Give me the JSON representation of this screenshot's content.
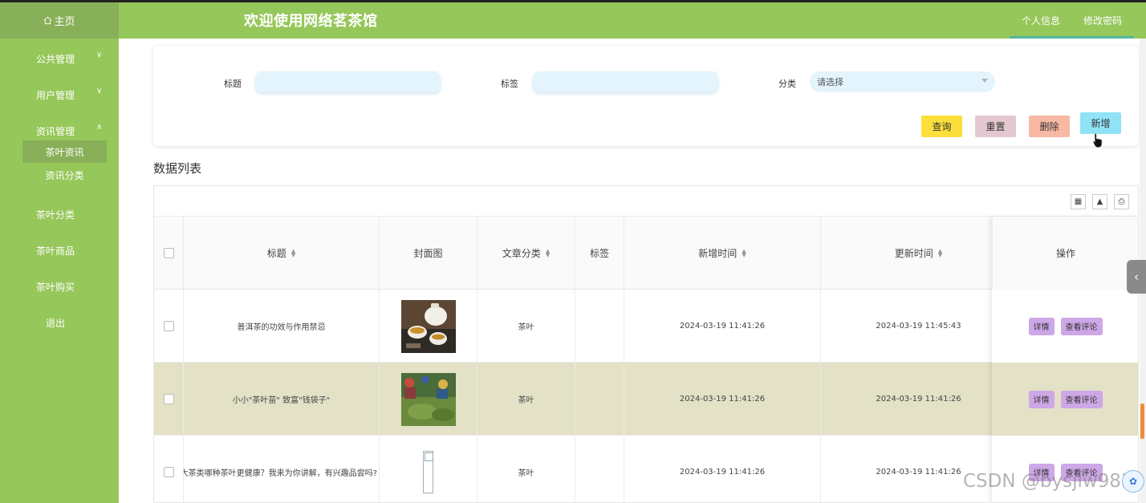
{
  "header": {
    "home_icon": "home-icon",
    "home_label": "主页",
    "title": "欢迎使用网络茗茶馆",
    "profile_link": "个人信息",
    "password_link": "修改密码"
  },
  "sidebar": {
    "items": [
      {
        "label": "公共管理",
        "expanded": false
      },
      {
        "label": "用户管理",
        "expanded": false
      },
      {
        "label": "资讯管理",
        "expanded": true
      },
      {
        "label": "茶叶分类"
      },
      {
        "label": "茶叶商品"
      },
      {
        "label": "茶叶购买"
      },
      {
        "label": "退出"
      }
    ],
    "sub_items": [
      "茶叶资讯",
      "资讯分类"
    ],
    "active_sub": "茶叶资讯"
  },
  "search": {
    "title_label": "标题",
    "title_value": "",
    "tag_label": "标签",
    "tag_value": "",
    "category_label": "分类",
    "category_placeholder": "请选择",
    "buttons": {
      "query": "查询",
      "reset": "重置",
      "delete": "删除",
      "add": "新增"
    }
  },
  "list": {
    "section_title": "数据列表",
    "toolbar_icons": [
      "columns-icon",
      "export-icon",
      "print-icon"
    ],
    "columns": [
      "标题",
      "封面图",
      "文章分类",
      "标签",
      "新增时间",
      "更新时间",
      "操作"
    ],
    "rows": [
      {
        "title": "普洱茶的功效与作用禁忌",
        "category": "茶叶",
        "tag": "",
        "created": "2024-03-19 11:41:26",
        "updated": "2024-03-19 11:45:43",
        "cover": "teaset"
      },
      {
        "title": "小小\"茶叶苗\" 致富\"钱袋子\"",
        "category": "茶叶",
        "tag": "",
        "created": "2024-03-19 11:41:26",
        "updated": "2024-03-19 11:41:26",
        "cover": "tea-field"
      },
      {
        "title": "六大茶类哪种茶叶更健康？我来为你讲解，有兴趣品尝吗?",
        "category": "茶叶",
        "tag": "",
        "created": "2024-03-19 11:41:26",
        "updated": "2024-03-19 11:41:26",
        "cover": "broken"
      }
    ],
    "row_actions": {
      "detail": "详情",
      "comments": "查看评论"
    }
  },
  "watermark": "CSDN @bysjlw985",
  "colors": {
    "primary": "#96c75a",
    "query": "#fddf3c",
    "reset": "#e4c8cf",
    "delete": "#f7b9a4",
    "add": "#8fe3f5",
    "action": "#cda7e6",
    "highlight_row": "#e3e1c6"
  }
}
